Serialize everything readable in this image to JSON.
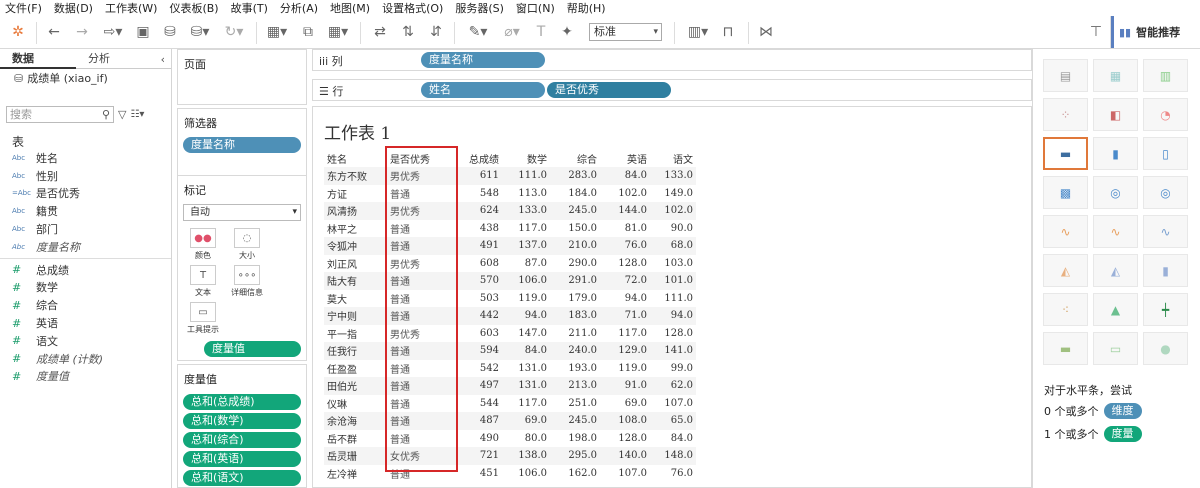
{
  "menu": [
    "文件(F)",
    "数据(D)",
    "工作表(W)",
    "仪表板(B)",
    "故事(T)",
    "分析(A)",
    "地图(M)",
    "设置格式(O)",
    "服务器(S)",
    "窗口(N)",
    "帮助(H)"
  ],
  "toolbar": {
    "fit_select": "标准",
    "smart_label": "智能推荐"
  },
  "left": {
    "tab_data": "数据",
    "tab_analysis": "分析",
    "datasource": "成绩单 (xiao_if)",
    "search_placeholder": "搜索",
    "section_table": "表",
    "dimensions": [
      {
        "type": "Abc",
        "name": "姓名"
      },
      {
        "type": "Abc",
        "name": "性别"
      },
      {
        "type": "=Abc",
        "name": "是否优秀"
      },
      {
        "type": "Abc",
        "name": "籍贯"
      },
      {
        "type": "Abc",
        "name": "部门"
      },
      {
        "type": "Abc",
        "name": "度量名称"
      }
    ],
    "measures": [
      {
        "type": "#",
        "name": "总成绩"
      },
      {
        "type": "#",
        "name": "数学"
      },
      {
        "type": "#",
        "name": "综合"
      },
      {
        "type": "#",
        "name": "英语"
      },
      {
        "type": "#",
        "name": "语文"
      },
      {
        "type": "#",
        "name": "成绩单 (计数)"
      },
      {
        "type": "#",
        "name": "度量值"
      }
    ]
  },
  "cards": {
    "pages": "页面",
    "filters": "筛选器",
    "filter_pill": "度量名称",
    "marks": "标记",
    "marks_type": "自动",
    "mark_buttons": [
      "颜色",
      "大小",
      "文本",
      "详细信息",
      "工具提示"
    ],
    "marks_pill": "度量值",
    "measure_values": "度量值",
    "mv_pills": [
      "总和(总成绩)",
      "总和(数学)",
      "总和(综合)",
      "总和(英语)",
      "总和(语文)"
    ]
  },
  "shelves": {
    "cols_label": "列",
    "rows_label": "行",
    "cols_pill": "度量名称",
    "rows_pills": [
      "姓名",
      "是否优秀"
    ]
  },
  "worksheet": {
    "title": "工作表 1",
    "headers": [
      "姓名",
      "是否优秀",
      "总成绩",
      "数学",
      "综合",
      "英语",
      "语文"
    ],
    "rows": [
      [
        "东方不败",
        "男优秀",
        "611",
        "111.0",
        "283.0",
        "84.0",
        "133.0"
      ],
      [
        "方证",
        "普通",
        "548",
        "113.0",
        "184.0",
        "102.0",
        "149.0"
      ],
      [
        "风清扬",
        "男优秀",
        "624",
        "133.0",
        "245.0",
        "144.0",
        "102.0"
      ],
      [
        "林平之",
        "普通",
        "438",
        "117.0",
        "150.0",
        "81.0",
        "90.0"
      ],
      [
        "令狐冲",
        "普通",
        "491",
        "137.0",
        "210.0",
        "76.0",
        "68.0"
      ],
      [
        "刘正风",
        "男优秀",
        "608",
        "87.0",
        "290.0",
        "128.0",
        "103.0"
      ],
      [
        "陆大有",
        "普通",
        "570",
        "106.0",
        "291.0",
        "72.0",
        "101.0"
      ],
      [
        "莫大",
        "普通",
        "503",
        "119.0",
        "179.0",
        "94.0",
        "111.0"
      ],
      [
        "宁中则",
        "普通",
        "442",
        "94.0",
        "183.0",
        "71.0",
        "94.0"
      ],
      [
        "平一指",
        "男优秀",
        "603",
        "147.0",
        "211.0",
        "117.0",
        "128.0"
      ],
      [
        "任我行",
        "普通",
        "594",
        "84.0",
        "240.0",
        "129.0",
        "141.0"
      ],
      [
        "任盈盈",
        "普通",
        "542",
        "131.0",
        "193.0",
        "119.0",
        "99.0"
      ],
      [
        "田伯光",
        "普通",
        "497",
        "131.0",
        "213.0",
        "91.0",
        "62.0"
      ],
      [
        "仪琳",
        "普通",
        "544",
        "117.0",
        "251.0",
        "69.0",
        "107.0"
      ],
      [
        "余沧海",
        "普通",
        "487",
        "69.0",
        "245.0",
        "108.0",
        "65.0"
      ],
      [
        "岳不群",
        "普通",
        "490",
        "80.0",
        "198.0",
        "128.0",
        "84.0"
      ],
      [
        "岳灵珊",
        "女优秀",
        "721",
        "138.0",
        "295.0",
        "140.0",
        "148.0"
      ],
      [
        "左冷禅",
        "普通",
        "451",
        "106.0",
        "162.0",
        "107.0",
        "76.0"
      ]
    ]
  },
  "showme": {
    "hint": "对于水平条，尝试",
    "line1_prefix": "0 个或多个",
    "line1_pill": "维度",
    "line2_prefix": "1 个或多个",
    "line2_pill": "度量"
  },
  "colors": {
    "pill_blue": "#4e90b7",
    "pill_green": "#12a67a",
    "highlight": "#d62728"
  }
}
